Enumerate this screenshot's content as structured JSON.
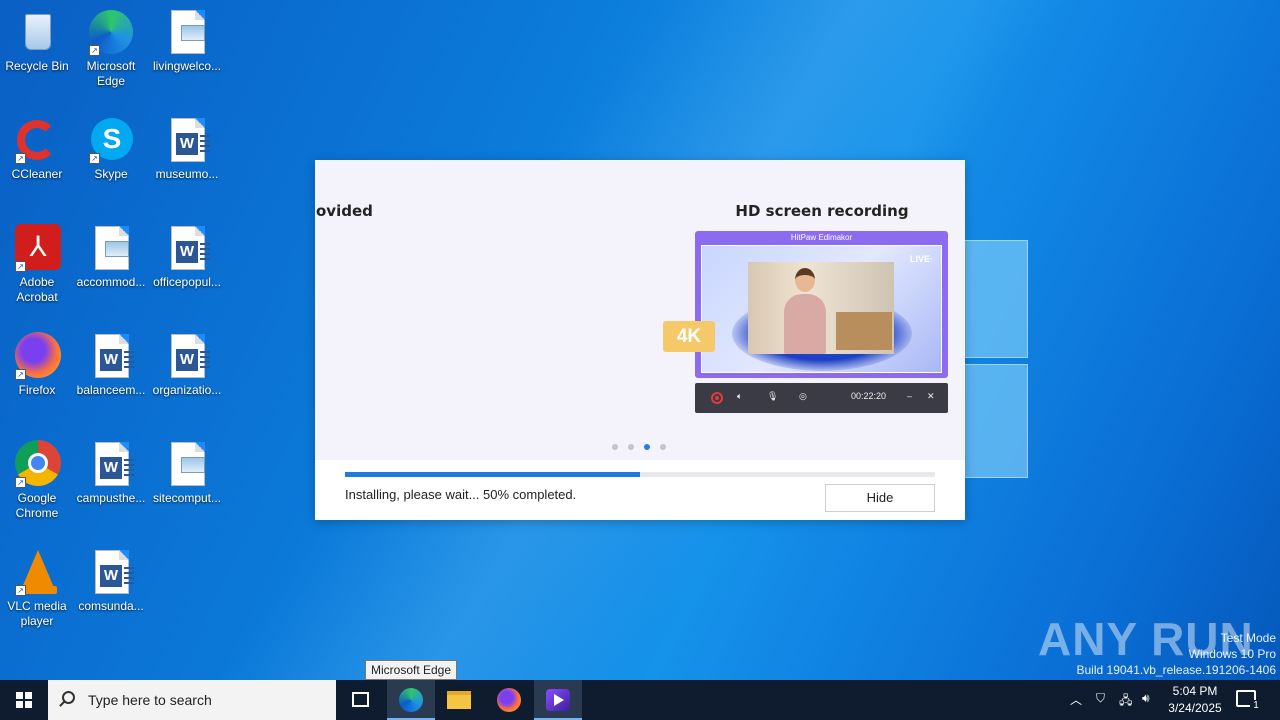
{
  "desktop": {
    "icons": [
      {
        "label": "Recycle Bin",
        "icon": "recycle-bin-icon"
      },
      {
        "label": "Microsoft Edge",
        "icon": "edge-icon"
      },
      {
        "label": "livingwelco...",
        "icon": "image-file-icon"
      },
      {
        "label": "CCleaner",
        "icon": "ccleaner-icon"
      },
      {
        "label": "Skype",
        "icon": "skype-icon"
      },
      {
        "label": "museumo...",
        "icon": "word-doc-icon"
      },
      {
        "label": "Adobe Acrobat",
        "icon": "acrobat-icon"
      },
      {
        "label": "accommod...",
        "icon": "image-file-icon"
      },
      {
        "label": "officepopul...",
        "icon": "word-doc-icon"
      },
      {
        "label": "Firefox",
        "icon": "firefox-icon"
      },
      {
        "label": "balanceem...",
        "icon": "word-doc-icon"
      },
      {
        "label": "organizatio...",
        "icon": "word-doc-icon"
      },
      {
        "label": "Google Chrome",
        "icon": "chrome-icon"
      },
      {
        "label": "campusthe...",
        "icon": "word-doc-icon"
      },
      {
        "label": "sitecomput...",
        "icon": "image-file-icon"
      },
      {
        "label": "VLC media player",
        "icon": "vlc-icon"
      },
      {
        "label": "comsunda...",
        "icon": "word-doc-icon"
      }
    ]
  },
  "installer": {
    "prev_slide_title": "ovided",
    "slide_title": "HD screen recording",
    "mock_app_title": "HitPaw Edimakor",
    "live_label": "LIVE·",
    "badge_4k": "4K",
    "rec_time": "00:22:20",
    "carousel_dots": 4,
    "carousel_active": 2,
    "progress_percent": 50,
    "status": "Installing, please wait... 50% completed.",
    "hide_label": "Hide"
  },
  "tooltip": "Microsoft Edge",
  "watermark": {
    "brand": "ANY RUN",
    "line1": "Test Mode",
    "line2": "Windows 10 Pro",
    "line3": "Build 19041.vb_release.191206-1406"
  },
  "taskbar": {
    "search_placeholder": "Type here to search",
    "time": "5:04 PM",
    "date": "3/24/2025",
    "notification_count": "1"
  },
  "colors": {
    "accent": "#1e7be0",
    "badge_4k": "#f5c869",
    "mock_purple": "#8b6cf0",
    "taskbar": "#0f1c2f"
  }
}
